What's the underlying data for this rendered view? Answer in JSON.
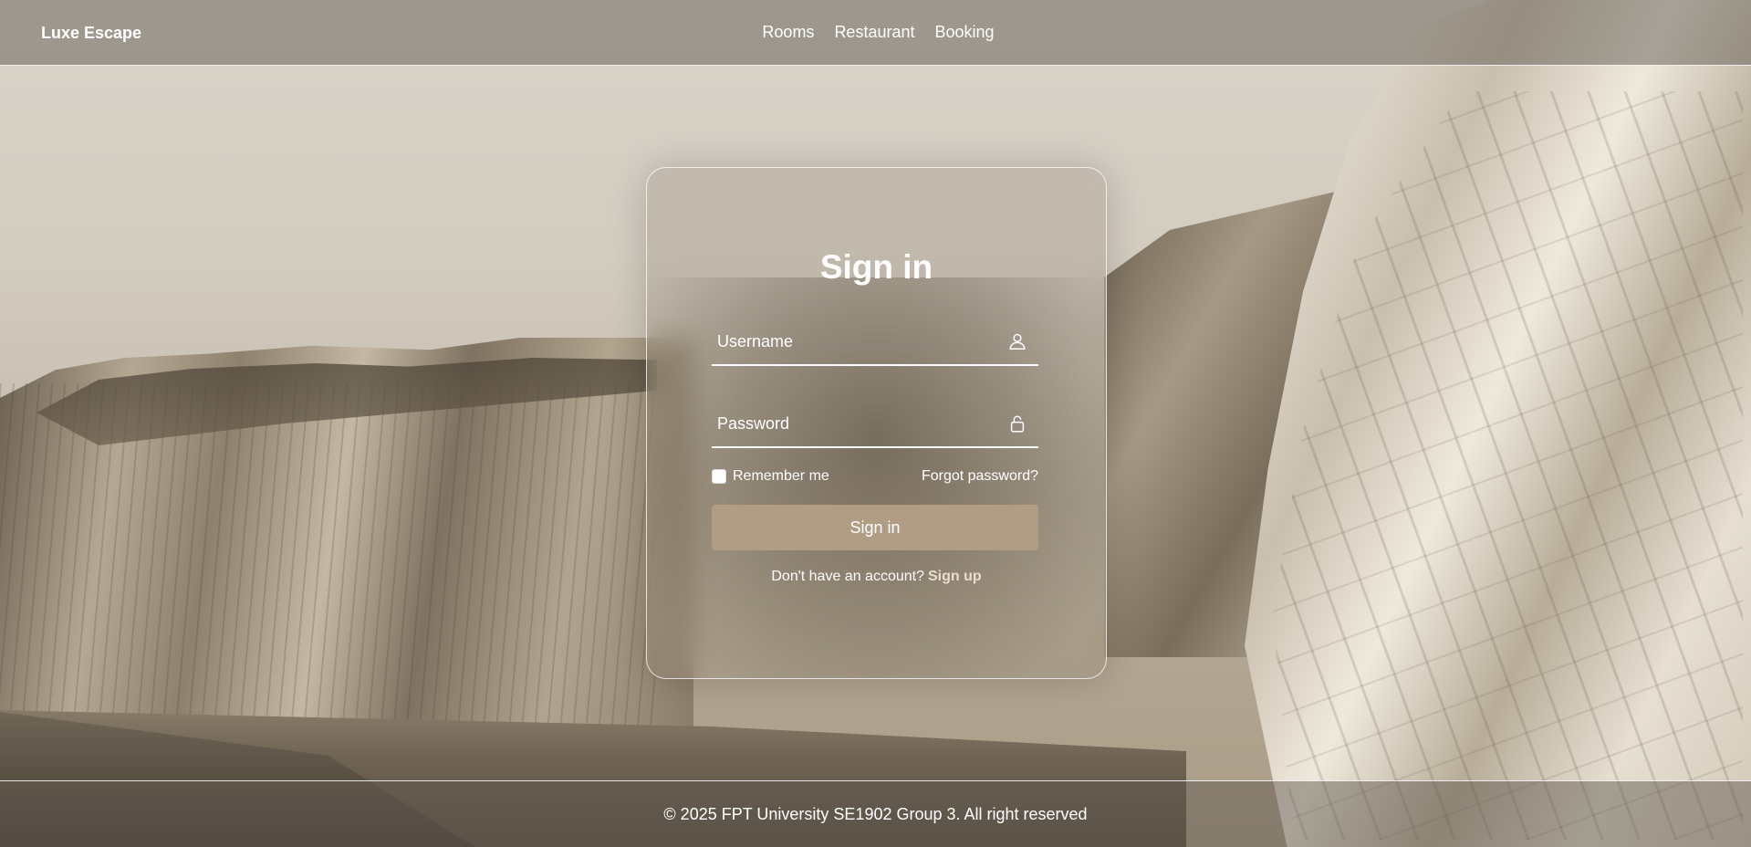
{
  "header": {
    "brand": "Luxe Escape",
    "nav": [
      "Rooms",
      "Restaurant",
      "Booking"
    ]
  },
  "login": {
    "title": "Sign in",
    "username_placeholder": "Username",
    "password_placeholder": "Password",
    "remember_label": "Remember me",
    "remember_checked": false,
    "forgot_label": "Forgot password?",
    "submit_label": "Sign in",
    "signup_prompt": "Don't have an account?",
    "signup_label": "Sign up",
    "icons": {
      "username": "user-icon",
      "password": "lock-icon"
    }
  },
  "footer": {
    "text": "© 2025 FPT University SE1902 Group 3. All right reserved"
  },
  "colors": {
    "button": "#b09d84",
    "signup_link": "#e8dccb"
  }
}
